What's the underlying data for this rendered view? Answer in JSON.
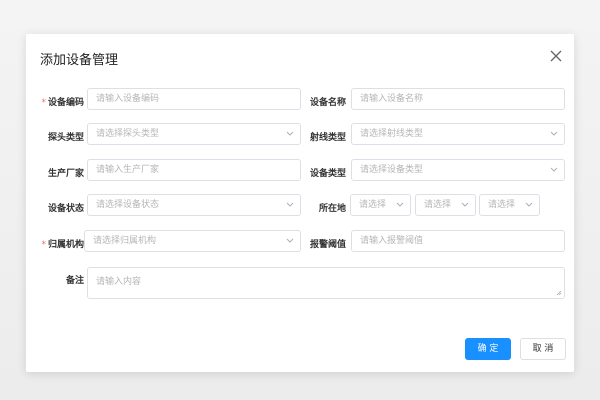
{
  "dialog": {
    "title": "添加设备管理",
    "close_icon": "close-icon"
  },
  "form": {
    "device_code": {
      "label": "设备编码",
      "required": true,
      "placeholder": "请输入设备编码"
    },
    "device_name": {
      "label": "设备名称",
      "required": false,
      "placeholder": "请输入设备名称"
    },
    "probe_type": {
      "label": "探头类型",
      "placeholder": "请选择探头类型"
    },
    "ray_type": {
      "label": "射线类型",
      "placeholder": "请选择射线类型"
    },
    "manufacturer": {
      "label": "生产厂家",
      "placeholder": "请输入生产厂家"
    },
    "device_type": {
      "label": "设备类型",
      "placeholder": "请选择设备类型"
    },
    "device_status": {
      "label": "设备状态",
      "placeholder": "请选择设备状态"
    },
    "location": {
      "label": "所在地",
      "placeholders": [
        "请选择",
        "请选择",
        "请选择"
      ]
    },
    "org": {
      "label": "归属机构",
      "required": true,
      "placeholder": "请选择归属机构"
    },
    "alarm_threshold": {
      "label": "报警阈值",
      "placeholder": "请输入报警阈值"
    },
    "remark": {
      "label": "备注",
      "placeholder": "请输入内容"
    }
  },
  "buttons": {
    "ok": "确 定",
    "cancel": "取 消"
  },
  "colors": {
    "primary": "#1890ff",
    "required": "#f56c6c",
    "border": "#dcdfe6"
  }
}
